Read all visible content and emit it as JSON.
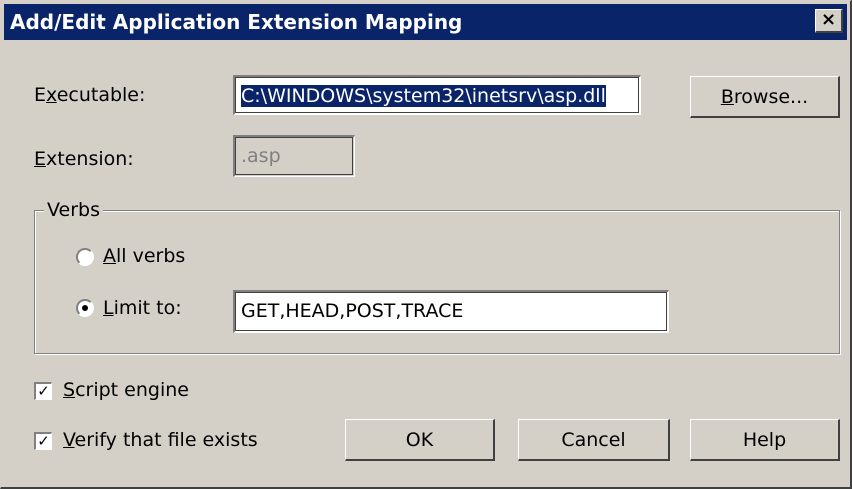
{
  "window": {
    "title": "Add/Edit Application Extension Mapping",
    "close_symbol": "×"
  },
  "executable": {
    "label_accel": "x",
    "label_pre": "E",
    "label_post": "ecutable:",
    "value": "C:\\WINDOWS\\system32\\inetsrv\\asp.dll",
    "browse_accel": "B",
    "browse_rest": "rowse..."
  },
  "extension": {
    "label_accel": "E",
    "label_rest": "xtension:",
    "value": ".asp"
  },
  "verbs": {
    "group_label": "Verbs",
    "all_accel": "A",
    "all_rest": "ll verbs",
    "all_selected": false,
    "limit_accel": "L",
    "limit_rest": "imit to:",
    "limit_selected": true,
    "limit_value": "GET,HEAD,POST,TRACE"
  },
  "options": {
    "script_accel": "S",
    "script_rest": "cript engine",
    "script_checked": true,
    "verify_accel": "V",
    "verify_rest": "erify that file exists",
    "verify_checked": true,
    "check_mark": "✓"
  },
  "buttons": {
    "ok": "OK",
    "cancel": "Cancel",
    "help": "Help"
  }
}
